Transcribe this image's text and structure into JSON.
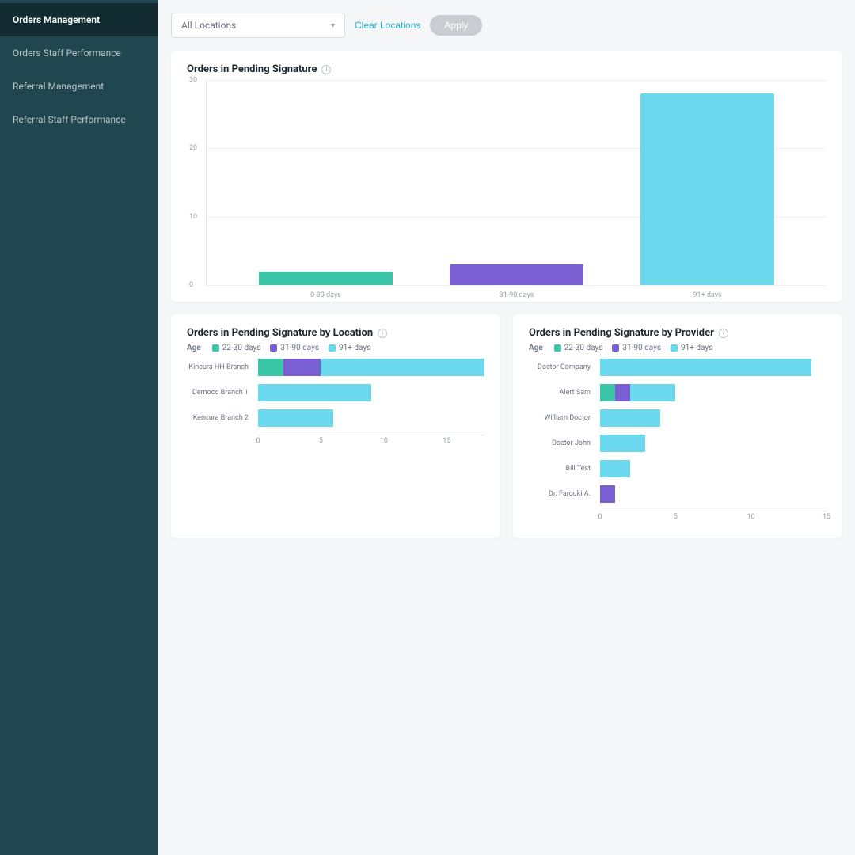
{
  "colors": {
    "teal": "#3bc6a7",
    "purple": "#7a5fd3",
    "cyan": "#6bd8ee",
    "sidebar": "#20464f",
    "sidebar_active": "#122c32"
  },
  "sidebar": {
    "items": [
      {
        "label": "Orders Management",
        "active": true
      },
      {
        "label": "Orders Staff Performance",
        "active": false
      },
      {
        "label": "Referral Management",
        "active": false
      },
      {
        "label": "Referral Staff Performance",
        "active": false
      }
    ]
  },
  "filters": {
    "location_selected": "All Locations",
    "clear_label": "Clear Locations",
    "apply_label": "Apply"
  },
  "chart_top": {
    "title": "Orders in Pending Signature"
  },
  "chart_left": {
    "title": "Orders in Pending Signature by Location",
    "legend_label": "Age"
  },
  "chart_right": {
    "title": "Orders in Pending Signature by Provider",
    "legend_label": "Age"
  },
  "legend_items": [
    {
      "name": "22-30 days",
      "color": "#3bc6a7"
    },
    {
      "name": "31-90 days",
      "color": "#7a5fd3"
    },
    {
      "name": "91+ days",
      "color": "#6bd8ee"
    }
  ],
  "chart_data": [
    {
      "id": "top",
      "type": "bar",
      "title": "Orders in Pending Signature",
      "categories": [
        "0-30 days",
        "31-90 days",
        "91+ days"
      ],
      "values": [
        2,
        3,
        28
      ],
      "colors": [
        "#3bc6a7",
        "#7a5fd3",
        "#6bd8ee"
      ],
      "yticks": [
        0,
        10,
        20,
        30
      ],
      "ylim": [
        0,
        30
      ]
    },
    {
      "id": "by_location",
      "type": "bar",
      "orientation": "horizontal",
      "stacked": true,
      "title": "Orders in Pending Signature by Location",
      "categories": [
        "Kincura HH Branch",
        "Democo Branch 1",
        "Kencura Branch 2"
      ],
      "series": [
        {
          "name": "22-30 days",
          "color": "#3bc6a7",
          "values": [
            2,
            0,
            0
          ]
        },
        {
          "name": "31-90 days",
          "color": "#7a5fd3",
          "values": [
            3,
            0,
            0
          ]
        },
        {
          "name": "91+ days",
          "color": "#6bd8ee",
          "values": [
            13,
            9,
            6
          ]
        }
      ],
      "xticks": [
        0,
        5,
        10,
        15
      ],
      "xlim": [
        0,
        18
      ]
    },
    {
      "id": "by_provider",
      "type": "bar",
      "orientation": "horizontal",
      "stacked": true,
      "title": "Orders in Pending Signature by Provider",
      "categories": [
        "Doctor Company",
        "Alert Sam",
        "William Doctor",
        "Doctor John",
        "Bill Test",
        "Dr. Farouki A."
      ],
      "series": [
        {
          "name": "22-30 days",
          "color": "#3bc6a7",
          "values": [
            0,
            1,
            0,
            0,
            0,
            0
          ]
        },
        {
          "name": "31-90 days",
          "color": "#7a5fd3",
          "values": [
            0,
            1,
            0,
            0,
            0,
            1
          ]
        },
        {
          "name": "91+ days",
          "color": "#6bd8ee",
          "values": [
            14,
            3,
            4,
            3,
            2,
            0
          ]
        }
      ],
      "xticks": [
        0,
        5,
        10,
        15
      ],
      "xlim": [
        0,
        15
      ]
    }
  ]
}
